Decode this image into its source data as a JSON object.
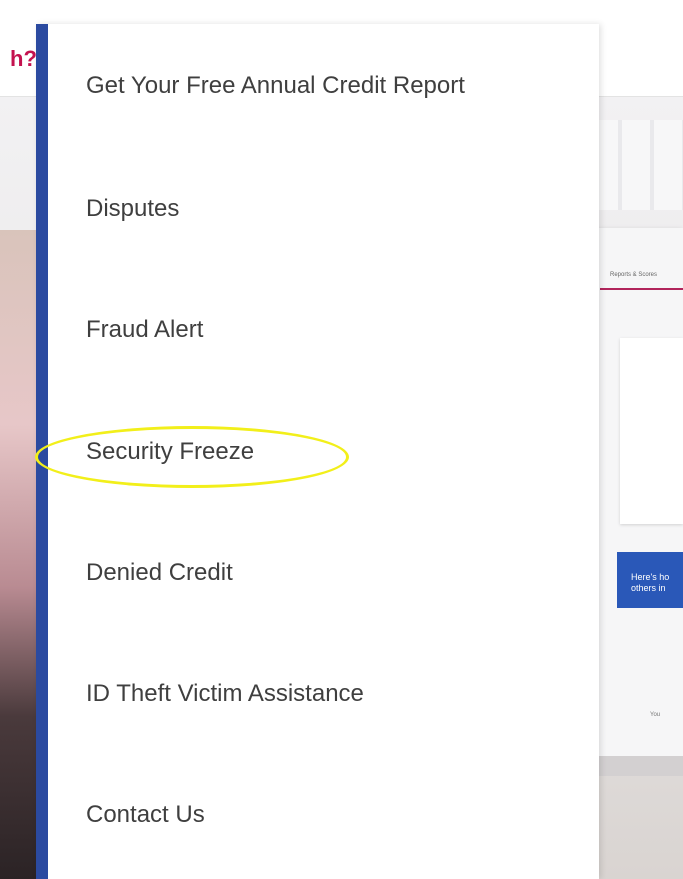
{
  "background": {
    "heading_fragment": "h?",
    "laptop_tab_label": "Reports & Scores",
    "laptop_blue_text": "Here's ho\nothers in",
    "laptop_you_label": "You"
  },
  "menu": {
    "accent_color": "#2b4aa0",
    "items": [
      {
        "label": "Get Your Free Annual Credit Report"
      },
      {
        "label": "Disputes"
      },
      {
        "label": "Fraud Alert"
      },
      {
        "label": "Security Freeze",
        "highlighted": true
      },
      {
        "label": "Denied Credit"
      },
      {
        "label": "ID Theft Victim Assistance"
      },
      {
        "label": "Contact Us"
      }
    ]
  },
  "annotation": {
    "highlight_color": "#f2ef1a",
    "target": "Security Freeze"
  }
}
